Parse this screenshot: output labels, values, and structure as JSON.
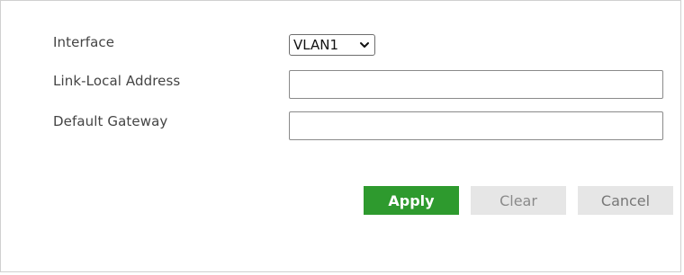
{
  "form": {
    "interface_label": "Interface",
    "interface_value": "VLAN1",
    "link_local_label": "Link-Local Address",
    "link_local_value": "",
    "default_gateway_label": "Default Gateway",
    "default_gateway_value": ""
  },
  "buttons": {
    "apply": "Apply",
    "clear": "Clear",
    "cancel": "Cancel"
  },
  "colors": {
    "apply_bg": "#2e9a2e",
    "secondary_bg": "#e6e6e6",
    "border": "#d0d0d0"
  },
  "icons": {
    "dropdown": "chevron-down-icon"
  }
}
